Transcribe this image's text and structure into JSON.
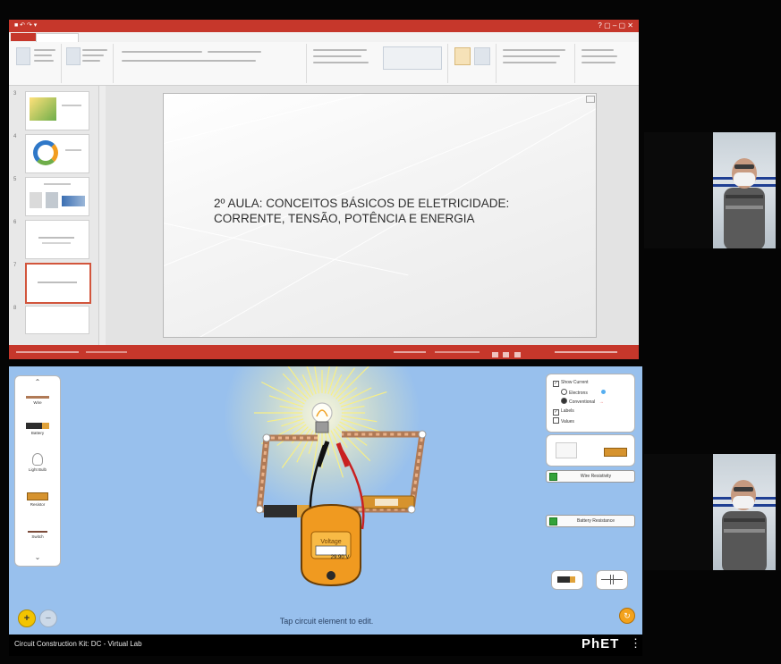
{
  "slide": {
    "title_line1": "2º AULA: CONCEITOS BÁSICOS DE ELETRICIDADE:",
    "title_line2": "CORRENTE, TENSÃO, POTÊNCIA E ENERGIA"
  },
  "ppt": {
    "slide_numbers": [
      "3",
      "4",
      "5",
      "6",
      "7",
      "8"
    ]
  },
  "phet": {
    "toolbox": [
      "Wire",
      "Battery",
      "Light Bulb",
      "Resistor",
      "Switch"
    ],
    "controls": {
      "show_current": "Show Current",
      "electrons": "Electrons",
      "conventional": "Conventional",
      "labels": "Labels",
      "values": "Values",
      "show_current_checked": true,
      "labels_checked": true,
      "values_checked": false,
      "selected_current": "Conventional"
    },
    "wire_resistivity": "Wire Resistivity",
    "battery_resistance": "Battery Resistance",
    "voltmeter_label": "Voltage",
    "voltmeter_reading": "29.90 V",
    "hint": "Tap circuit element to edit.",
    "sim_title": "Circuit Construction Kit: DC - Virtual Lab",
    "logo": "PhET"
  },
  "colors": {
    "ppt_accent": "#c6372b",
    "phet_bg": "#98c0ed",
    "voltmeter_body": "#f09a20"
  }
}
